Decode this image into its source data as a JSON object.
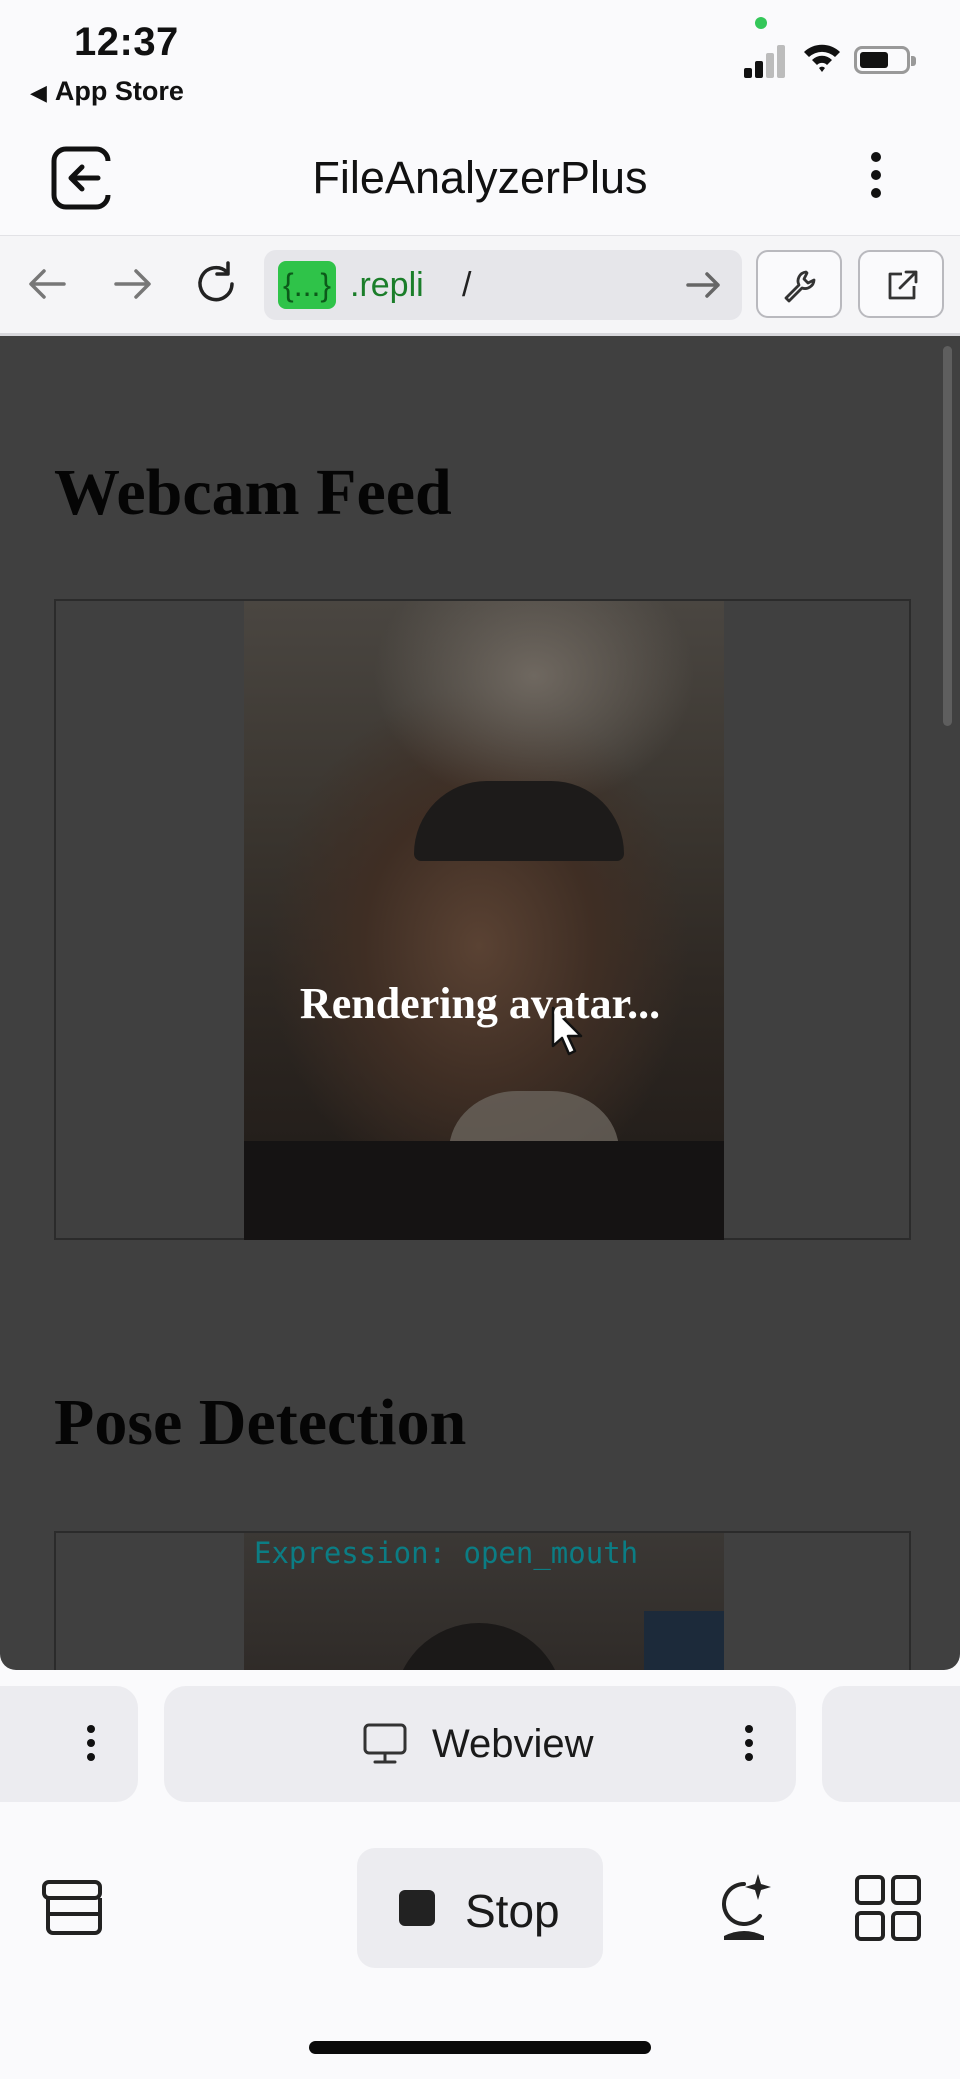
{
  "status_bar": {
    "time": "12:37",
    "back_app_label": "App Store",
    "back_icon": "triangle-left-icon",
    "icons": [
      "signal-icon",
      "wifi-icon",
      "battery-icon"
    ]
  },
  "header": {
    "title": "FileAnalyzerPlus",
    "exit_icon": "exit-icon",
    "menu_icon": "kebab-icon"
  },
  "toolbar": {
    "url_badge": "{...}",
    "url_host": ".repli",
    "url_path": "/",
    "icons": [
      "back-arrow-icon",
      "forward-arrow-icon",
      "reload-icon",
      "go-arrow-icon",
      "wrench-icon",
      "external-link-icon"
    ]
  },
  "webview": {
    "heading_feed": "Webcam Feed",
    "overlay_text": "Rendering avatar...",
    "heading_pose": "Pose Detection",
    "expression_text": "Expression: open_mouth",
    "cursor_icon": "mouse-pointer-icon"
  },
  "tabs": {
    "active_tab_label": "Webview",
    "active_tab_icon": "monitor-icon",
    "menu_icon": "kebab-icon"
  },
  "bottom_bar": {
    "stop_label": "Stop",
    "icons": [
      "layers-icon",
      "stop-icon",
      "ai-sparkle-icon",
      "grid-icon"
    ]
  },
  "colors": {
    "url_badge_bg": "#2fc349",
    "url_host_text": "#1b7e2a",
    "webview_bg": "#404040",
    "expression_text": "#0b7d84"
  }
}
